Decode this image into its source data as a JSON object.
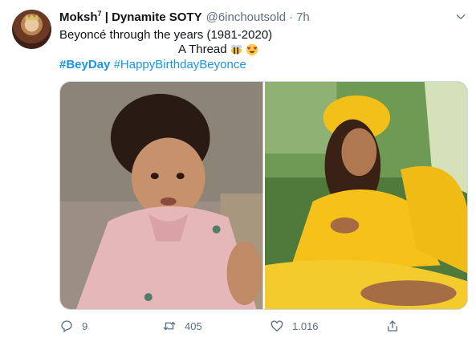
{
  "tweet": {
    "author_name": "Moksh",
    "author_superscript": "7",
    "author_suffix": " | Dynamite SOTY",
    "handle": "@6inchoutsold",
    "separator": "·",
    "time": "7h",
    "text_line1": "Beyoncé through the years (1981-2020)",
    "text_line2": "A Thread",
    "hashtags": [
      "#BeyDay",
      "#HappyBirthdayBeyonce"
    ],
    "media": [
      {
        "name": "baby-photo"
      },
      {
        "name": "yellow-dress-photo"
      }
    ],
    "actions": {
      "reply_count": "9",
      "retweet_count": "405",
      "like_count": "1.016"
    }
  },
  "icons": {
    "reply": "reply-icon",
    "retweet": "retweet-icon",
    "like": "like-icon",
    "share": "share-icon",
    "more": "chevron-down-icon",
    "bee": "bee-emoji",
    "heart_eyes": "heart-eyes-emoji"
  },
  "colors": {
    "link": "#1b95e0",
    "muted": "#5b7083",
    "text": "#0f1419"
  }
}
